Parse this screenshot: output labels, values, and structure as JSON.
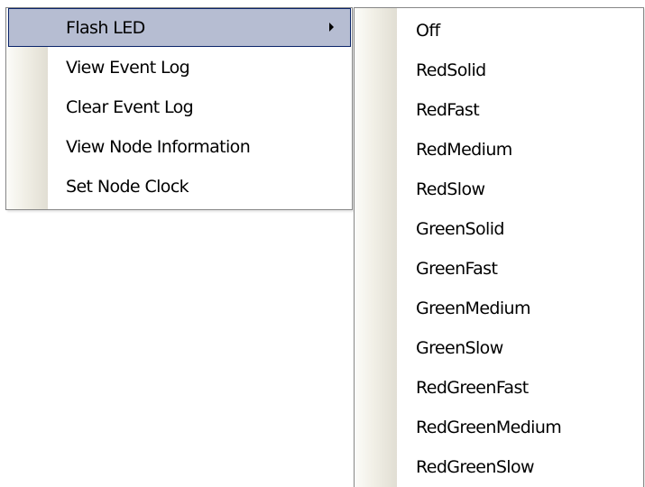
{
  "main_menu": {
    "items": [
      {
        "label": "Flash LED"
      },
      {
        "label": "View Event Log"
      },
      {
        "label": "Clear Event Log"
      },
      {
        "label": "View Node Information"
      },
      {
        "label": "Set Node Clock"
      }
    ],
    "highlighted": "Flash LED",
    "submenu_arrow_icon": "chevron-right-icon"
  },
  "submenu": {
    "items": [
      {
        "label": "Off"
      },
      {
        "label": "RedSolid"
      },
      {
        "label": "RedFast"
      },
      {
        "label": "RedMedium"
      },
      {
        "label": "RedSlow"
      },
      {
        "label": "GreenSolid"
      },
      {
        "label": "GreenFast"
      },
      {
        "label": "GreenMedium"
      },
      {
        "label": "GreenSlow"
      },
      {
        "label": "RedGreenFast"
      },
      {
        "label": "RedGreenMedium"
      },
      {
        "label": "RedGreenSlow"
      }
    ]
  },
  "colors": {
    "highlight_fill": "#b6bdd2",
    "highlight_border": "#0a246a",
    "menu_border": "#868686",
    "gutter": "#e1ded3"
  }
}
